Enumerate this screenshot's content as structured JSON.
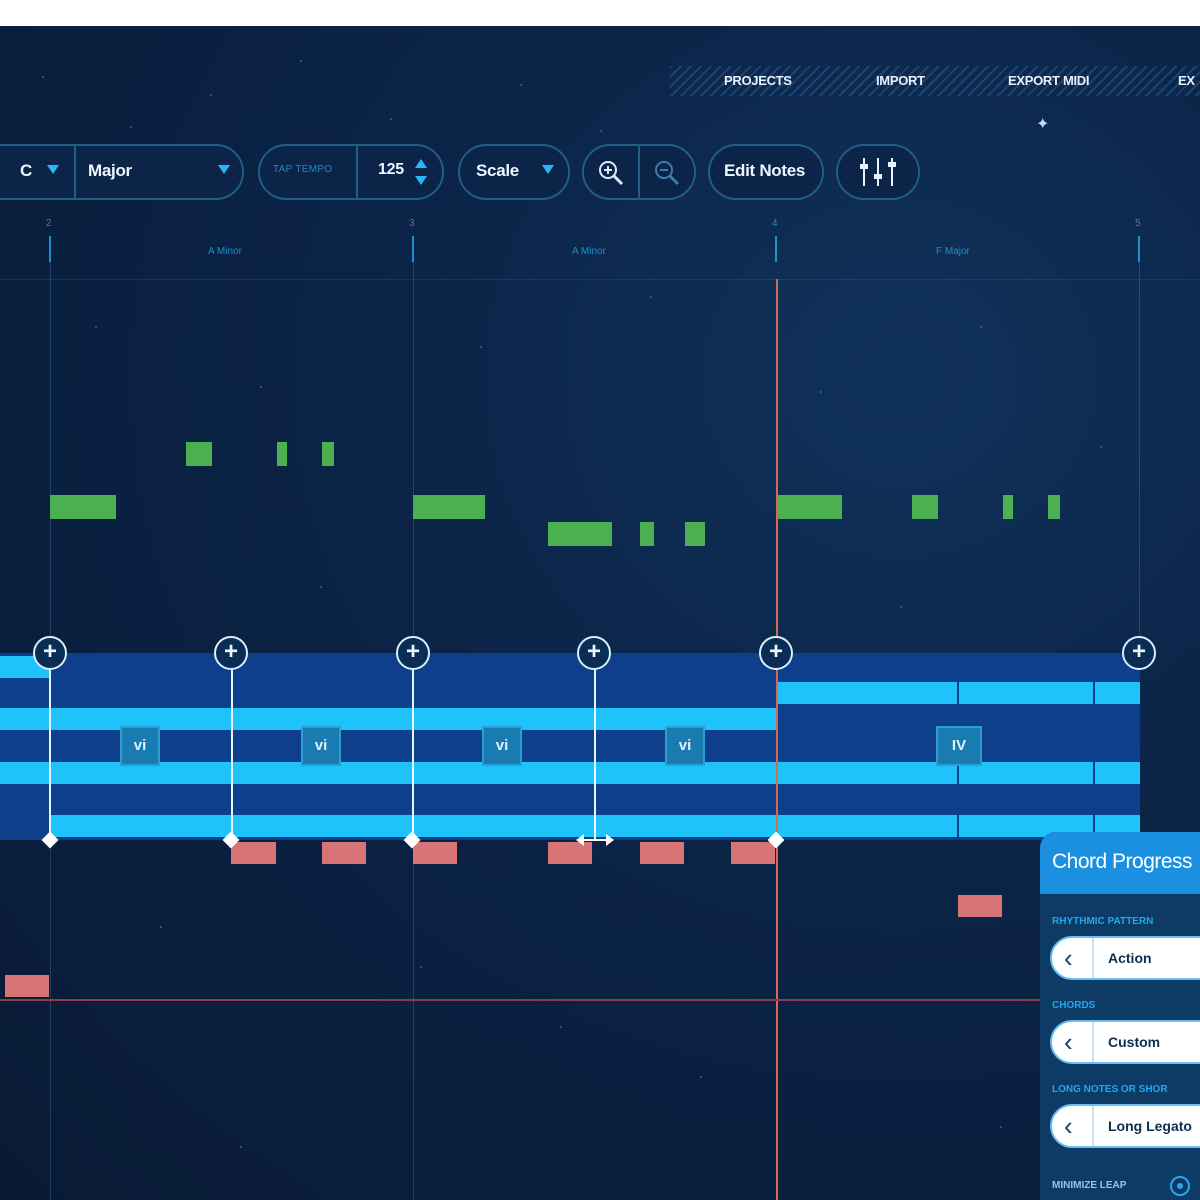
{
  "nav": {
    "links": [
      "PROJECTS",
      "IMPORT",
      "EXPORT MIDI",
      "EX"
    ]
  },
  "toolbar": {
    "key": "C",
    "scale_type": "Major",
    "tap_tempo_label": "TAP TEMPO",
    "tempo_value": "125",
    "scale_label": "Scale",
    "edit_notes_label": "Edit Notes"
  },
  "ruler": {
    "bar_numbers": [
      "2",
      "3",
      "4",
      "5"
    ],
    "chord_names": [
      "A Minor",
      "A Minor",
      "F Major"
    ]
  },
  "chords": {
    "numerals": [
      "vi",
      "vi",
      "vi",
      "vi",
      "IV"
    ]
  },
  "panel": {
    "title": "Chord Progress",
    "rhythmic_pattern_label": "RHYTHMIC PATTERN",
    "rhythmic_pattern_value": "Action",
    "chords_label": "CHORDS",
    "chords_value": "Custom",
    "long_notes_label": "LONG NOTES OR SHOR",
    "long_notes_value": "Long Legato",
    "minimize_leap_label": "MINIMIZE LEAP"
  },
  "colors": {
    "background": "#0b2447",
    "melody_note": "#4caf50",
    "bass_note": "#d77476",
    "chord_lane": "#1ec3fb",
    "playhead": "#d06a5a"
  }
}
